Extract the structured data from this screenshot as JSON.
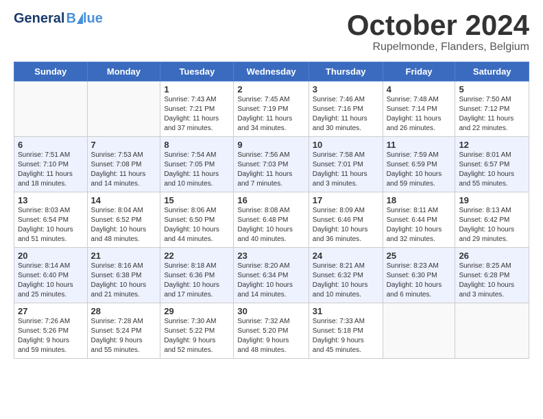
{
  "header": {
    "logo_general": "General",
    "logo_blue": "Blue",
    "month": "October 2024",
    "location": "Rupelmonde, Flanders, Belgium"
  },
  "weekdays": [
    "Sunday",
    "Monday",
    "Tuesday",
    "Wednesday",
    "Thursday",
    "Friday",
    "Saturday"
  ],
  "weeks": [
    [
      {
        "day": "",
        "info": ""
      },
      {
        "day": "",
        "info": ""
      },
      {
        "day": "1",
        "info": "Sunrise: 7:43 AM\nSunset: 7:21 PM\nDaylight: 11 hours and 37 minutes."
      },
      {
        "day": "2",
        "info": "Sunrise: 7:45 AM\nSunset: 7:19 PM\nDaylight: 11 hours and 34 minutes."
      },
      {
        "day": "3",
        "info": "Sunrise: 7:46 AM\nSunset: 7:16 PM\nDaylight: 11 hours and 30 minutes."
      },
      {
        "day": "4",
        "info": "Sunrise: 7:48 AM\nSunset: 7:14 PM\nDaylight: 11 hours and 26 minutes."
      },
      {
        "day": "5",
        "info": "Sunrise: 7:50 AM\nSunset: 7:12 PM\nDaylight: 11 hours and 22 minutes."
      }
    ],
    [
      {
        "day": "6",
        "info": "Sunrise: 7:51 AM\nSunset: 7:10 PM\nDaylight: 11 hours and 18 minutes."
      },
      {
        "day": "7",
        "info": "Sunrise: 7:53 AM\nSunset: 7:08 PM\nDaylight: 11 hours and 14 minutes."
      },
      {
        "day": "8",
        "info": "Sunrise: 7:54 AM\nSunset: 7:05 PM\nDaylight: 11 hours and 10 minutes."
      },
      {
        "day": "9",
        "info": "Sunrise: 7:56 AM\nSunset: 7:03 PM\nDaylight: 11 hours and 7 minutes."
      },
      {
        "day": "10",
        "info": "Sunrise: 7:58 AM\nSunset: 7:01 PM\nDaylight: 11 hours and 3 minutes."
      },
      {
        "day": "11",
        "info": "Sunrise: 7:59 AM\nSunset: 6:59 PM\nDaylight: 10 hours and 59 minutes."
      },
      {
        "day": "12",
        "info": "Sunrise: 8:01 AM\nSunset: 6:57 PM\nDaylight: 10 hours and 55 minutes."
      }
    ],
    [
      {
        "day": "13",
        "info": "Sunrise: 8:03 AM\nSunset: 6:54 PM\nDaylight: 10 hours and 51 minutes."
      },
      {
        "day": "14",
        "info": "Sunrise: 8:04 AM\nSunset: 6:52 PM\nDaylight: 10 hours and 48 minutes."
      },
      {
        "day": "15",
        "info": "Sunrise: 8:06 AM\nSunset: 6:50 PM\nDaylight: 10 hours and 44 minutes."
      },
      {
        "day": "16",
        "info": "Sunrise: 8:08 AM\nSunset: 6:48 PM\nDaylight: 10 hours and 40 minutes."
      },
      {
        "day": "17",
        "info": "Sunrise: 8:09 AM\nSunset: 6:46 PM\nDaylight: 10 hours and 36 minutes."
      },
      {
        "day": "18",
        "info": "Sunrise: 8:11 AM\nSunset: 6:44 PM\nDaylight: 10 hours and 32 minutes."
      },
      {
        "day": "19",
        "info": "Sunrise: 8:13 AM\nSunset: 6:42 PM\nDaylight: 10 hours and 29 minutes."
      }
    ],
    [
      {
        "day": "20",
        "info": "Sunrise: 8:14 AM\nSunset: 6:40 PM\nDaylight: 10 hours and 25 minutes."
      },
      {
        "day": "21",
        "info": "Sunrise: 8:16 AM\nSunset: 6:38 PM\nDaylight: 10 hours and 21 minutes."
      },
      {
        "day": "22",
        "info": "Sunrise: 8:18 AM\nSunset: 6:36 PM\nDaylight: 10 hours and 17 minutes."
      },
      {
        "day": "23",
        "info": "Sunrise: 8:20 AM\nSunset: 6:34 PM\nDaylight: 10 hours and 14 minutes."
      },
      {
        "day": "24",
        "info": "Sunrise: 8:21 AM\nSunset: 6:32 PM\nDaylight: 10 hours and 10 minutes."
      },
      {
        "day": "25",
        "info": "Sunrise: 8:23 AM\nSunset: 6:30 PM\nDaylight: 10 hours and 6 minutes."
      },
      {
        "day": "26",
        "info": "Sunrise: 8:25 AM\nSunset: 6:28 PM\nDaylight: 10 hours and 3 minutes."
      }
    ],
    [
      {
        "day": "27",
        "info": "Sunrise: 7:26 AM\nSunset: 5:26 PM\nDaylight: 9 hours and 59 minutes."
      },
      {
        "day": "28",
        "info": "Sunrise: 7:28 AM\nSunset: 5:24 PM\nDaylight: 9 hours and 55 minutes."
      },
      {
        "day": "29",
        "info": "Sunrise: 7:30 AM\nSunset: 5:22 PM\nDaylight: 9 hours and 52 minutes."
      },
      {
        "day": "30",
        "info": "Sunrise: 7:32 AM\nSunset: 5:20 PM\nDaylight: 9 hours and 48 minutes."
      },
      {
        "day": "31",
        "info": "Sunrise: 7:33 AM\nSunset: 5:18 PM\nDaylight: 9 hours and 45 minutes."
      },
      {
        "day": "",
        "info": ""
      },
      {
        "day": "",
        "info": ""
      }
    ]
  ]
}
